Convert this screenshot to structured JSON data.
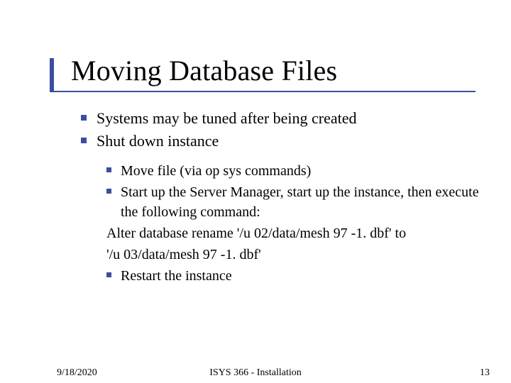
{
  "title": "Moving Database Files",
  "level1": [
    "Systems may be tuned after being created",
    "Shut down instance"
  ],
  "level2_block": {
    "items_top": [
      "Move file (via op sys commands)",
      "Start up the Server Manager, start up the instance, then execute the following command:"
    ],
    "plain": [
      "Alter database rename '/u 02/data/mesh 97 -1. dbf' to",
      "'/u 03/data/mesh 97 -1. dbf'"
    ],
    "items_bottom": [
      "Restart the instance"
    ]
  },
  "footer": {
    "date": "9/18/2020",
    "center": "ISYS 366 - Installation",
    "page": "13"
  }
}
